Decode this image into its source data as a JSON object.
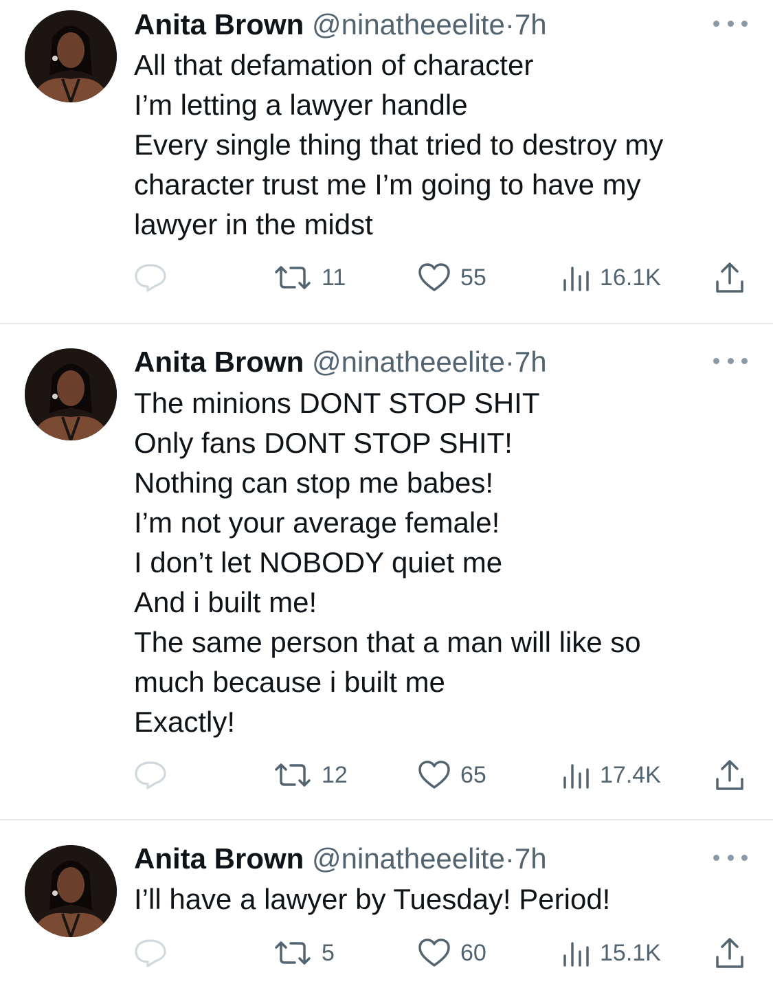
{
  "tweets": [
    {
      "author": {
        "name": "Anita Brown",
        "handle": "@ninatheeelite",
        "dot": "·",
        "time": "7h"
      },
      "lines": [
        "All that defamation of character",
        "I’m letting a lawyer handle",
        "Every single thing that tried to destroy my",
        "character trust me I’m going to have my",
        "lawyer in the midst"
      ],
      "stats": {
        "retweets": "11",
        "likes": "55",
        "views": "16.1K"
      }
    },
    {
      "author": {
        "name": "Anita Brown",
        "handle": "@ninatheeelite",
        "dot": "·",
        "time": "7h"
      },
      "lines": [
        "The minions DONT STOP SHIT",
        "Only fans DONT STOP SHIT!",
        "Nothing can stop me babes!",
        "I’m not your average female!",
        "I don’t let NOBODY quiet me",
        "And i built me!",
        "The same person that a man will like so",
        "much because i built me",
        "Exactly!"
      ],
      "stats": {
        "retweets": "12",
        "likes": "65",
        "views": "17.4K"
      }
    },
    {
      "author": {
        "name": "Anita Brown",
        "handle": "@ninatheeelite",
        "dot": "·",
        "time": "7h"
      },
      "lines": [
        "I’ll have a lawyer by Tuesday! Period!"
      ],
      "stats": {
        "retweets": "5",
        "likes": "60",
        "views": "15.1K"
      }
    }
  ],
  "icons": {
    "reply": "reply-icon",
    "retweet": "retweet-icon",
    "like": "heart-icon",
    "views": "views-icon",
    "share": "share-icon",
    "more": "more-icon"
  },
  "colors": {
    "text": "#0f1419",
    "secondary": "#536471",
    "divider": "#e6e9ec",
    "reply_icon": "#cfd9de"
  }
}
